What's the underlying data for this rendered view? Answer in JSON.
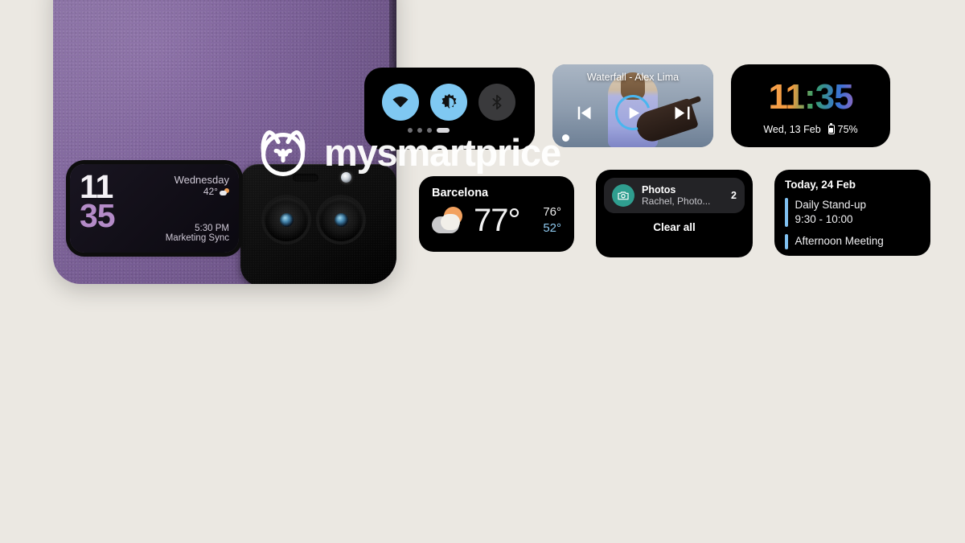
{
  "page": {
    "background_color": "#ebe8e2",
    "title": "Motorola Razr cover display and companion widgets render"
  },
  "phone": {
    "body_color": "#7d629a",
    "finish": "purple leather texture",
    "camera": {
      "lens_count": 2,
      "flash_icon": "flash-icon",
      "sensor_icon": "sensor-slot-icon"
    },
    "cover_display": {
      "time_hours": "11",
      "time_minutes": "35",
      "day": "Wednesday",
      "temperature": "42°",
      "weather_icon": "partly-cloudy-icon",
      "event_time": "5:30 PM",
      "event_name": "Marketing Sync",
      "hours_color": "#f4f1f6",
      "minutes_color": "#b48bc8"
    },
    "side_buttons": [
      "volume-button",
      "power-button"
    ]
  },
  "widgets": {
    "quick_settings": {
      "name": "Quick settings",
      "toggles": [
        {
          "icon": "wifi-icon",
          "label": "Wi-Fi",
          "state": "on"
        },
        {
          "icon": "brightness-icon",
          "label": "Brightness",
          "state": "on"
        },
        {
          "icon": "bluetooth-icon",
          "label": "Bluetooth",
          "state": "off"
        }
      ],
      "page_dots": 4,
      "active_dot_index": 3,
      "on_color": "#7fc8f2",
      "off_color": "#3a3a3c"
    },
    "media": {
      "name": "Media player",
      "track_title": "Waterfall - Alex Lima",
      "controls": [
        {
          "icon": "previous-track-icon",
          "label": "Previous"
        },
        {
          "icon": "play-icon",
          "label": "Play"
        },
        {
          "icon": "next-track-icon",
          "label": "Next"
        }
      ],
      "progress_ring_color": "#49b6ef"
    },
    "clock": {
      "name": "Clock",
      "time": "11:35",
      "date": "Wed, 13 Feb",
      "battery_icon": "battery-icon",
      "battery_level": "75%"
    },
    "weather": {
      "name": "Weather",
      "city": "Barcelona",
      "current_temp": "77°",
      "high_temp": "76°",
      "low_temp": "52°",
      "condition_icon": "partly-cloudy-icon",
      "low_color": "#8ec9ef"
    },
    "notifications": {
      "name": "Notifications",
      "items": [
        {
          "app": "Photos",
          "summary": "Rachel, Photo...",
          "count": "2",
          "icon": "camera-icon",
          "icon_color": "#2f9e8f"
        }
      ],
      "clear_all_label": "Clear all"
    },
    "calendar": {
      "name": "Calendar",
      "header": "Today, 24 Feb",
      "events": [
        {
          "title": "Daily Stand-up",
          "time": "9:30 - 10:00",
          "accent": "#7fc0f0"
        },
        {
          "title": "Afternoon Meeting",
          "time": "",
          "accent": "#7fc0f0"
        }
      ]
    }
  },
  "watermark": {
    "text": "mysmartprice",
    "logo_icon": "owl-logo-icon"
  }
}
